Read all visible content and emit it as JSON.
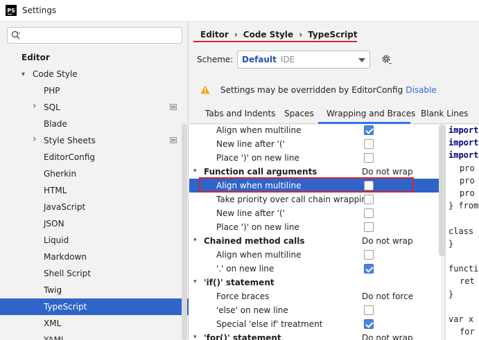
{
  "window": {
    "title": "Settings",
    "app_icon": "PS"
  },
  "sidebar": {
    "search_placeholder": "",
    "items": [
      {
        "label": "Editor",
        "level": 0,
        "bold": true
      },
      {
        "label": "Code Style",
        "level": 1,
        "expanded": true
      },
      {
        "label": "PHP",
        "level": 2
      },
      {
        "label": "SQL",
        "level": 2,
        "collapsed": true,
        "badge": true
      },
      {
        "label": "Blade",
        "level": 2
      },
      {
        "label": "Style Sheets",
        "level": 2,
        "collapsed": true,
        "badge": true
      },
      {
        "label": "EditorConfig",
        "level": 2
      },
      {
        "label": "Gherkin",
        "level": 2
      },
      {
        "label": "HTML",
        "level": 2
      },
      {
        "label": "JavaScript",
        "level": 2
      },
      {
        "label": "JSON",
        "level": 2
      },
      {
        "label": "Liquid",
        "level": 2
      },
      {
        "label": "Markdown",
        "level": 2
      },
      {
        "label": "Shell Script",
        "level": 2
      },
      {
        "label": "Twig",
        "level": 2
      },
      {
        "label": "TypeScript",
        "level": 2,
        "selected": true
      },
      {
        "label": "XML",
        "level": 2
      },
      {
        "label": "YAML",
        "level": 2
      }
    ]
  },
  "breadcrumb": {
    "parts": [
      "Editor",
      "Code Style",
      "TypeScript"
    ],
    "separator": "›"
  },
  "scheme": {
    "label": "Scheme:",
    "name": "Default",
    "type": "IDE"
  },
  "notice": {
    "text": "Settings may be overridden by EditorConfig",
    "link": "Disable"
  },
  "tabs": [
    {
      "label": "Tabs and Indents"
    },
    {
      "label": "Spaces"
    },
    {
      "label": "Wrapping and Braces",
      "active": true
    },
    {
      "label": "Blank Lines"
    }
  ],
  "options": [
    {
      "label": "Align when multiline",
      "type": "checkbox",
      "checked": true
    },
    {
      "label": "New line after '('",
      "type": "checkbox",
      "checked": false
    },
    {
      "label": "Place ')' on new line",
      "type": "checkbox",
      "checked": false
    },
    {
      "label": "Function call arguments",
      "type": "group",
      "value": "Do not wrap"
    },
    {
      "label": "Align when multiline",
      "type": "checkbox",
      "checked": false,
      "selected": true
    },
    {
      "label": "Take priority over call chain wrapping",
      "type": "checkbox",
      "checked": false
    },
    {
      "label": "New line after '('",
      "type": "checkbox",
      "checked": false
    },
    {
      "label": "Place ')' on new line",
      "type": "checkbox",
      "checked": false
    },
    {
      "label": "Chained method calls",
      "type": "group",
      "value": "Do not wrap"
    },
    {
      "label": "Align when multiline",
      "type": "checkbox",
      "checked": false
    },
    {
      "label": "'.' on new line",
      "type": "checkbox",
      "checked": true
    },
    {
      "label": "'if()' statement",
      "type": "group",
      "value": ""
    },
    {
      "label": "Force braces",
      "type": "value",
      "value": "Do not force"
    },
    {
      "label": "'else' on new line",
      "type": "checkbox",
      "checked": false
    },
    {
      "label": "Special 'else if' treatment",
      "type": "checkbox",
      "checked": true
    },
    {
      "label": "'for()' statement",
      "type": "group",
      "value": "Do not wrap"
    }
  ],
  "preview_lines": [
    {
      "text": "import",
      "kw": true,
      "indent": 0
    },
    {
      "text": "import",
      "kw": true,
      "indent": 0
    },
    {
      "text": "import",
      "kw": true,
      "indent": 0
    },
    {
      "text": "pro",
      "kw": false,
      "indent": 1
    },
    {
      "text": "pro",
      "kw": false,
      "indent": 1
    },
    {
      "text": "pro",
      "kw": false,
      "indent": 1
    },
    {
      "text": "} from",
      "kw": false,
      "indent": 0
    },
    {
      "text": "",
      "kw": false,
      "indent": 0
    },
    {
      "text": "class N",
      "kw": false,
      "indent": 0
    },
    {
      "text": "}",
      "kw": false,
      "indent": 0
    },
    {
      "text": "",
      "kw": false,
      "indent": 0
    },
    {
      "text": "functio",
      "kw": false,
      "indent": 0
    },
    {
      "text": "ret",
      "kw": false,
      "indent": 1
    },
    {
      "text": "}",
      "kw": false,
      "indent": 0
    },
    {
      "text": "",
      "kw": false,
      "indent": 0
    },
    {
      "text": "var x =",
      "kw": false,
      "indent": 0
    },
    {
      "text": "for",
      "kw": false,
      "indent": 1
    },
    {
      "text": "",
      "kw": false,
      "indent": 1
    }
  ],
  "colors": {
    "selection": "#2f65ca",
    "annotation_red": "#d6262b",
    "link": "#2a6bd6",
    "scheme_name": "#2a4eb4",
    "tab_accent": "#3574f0"
  }
}
